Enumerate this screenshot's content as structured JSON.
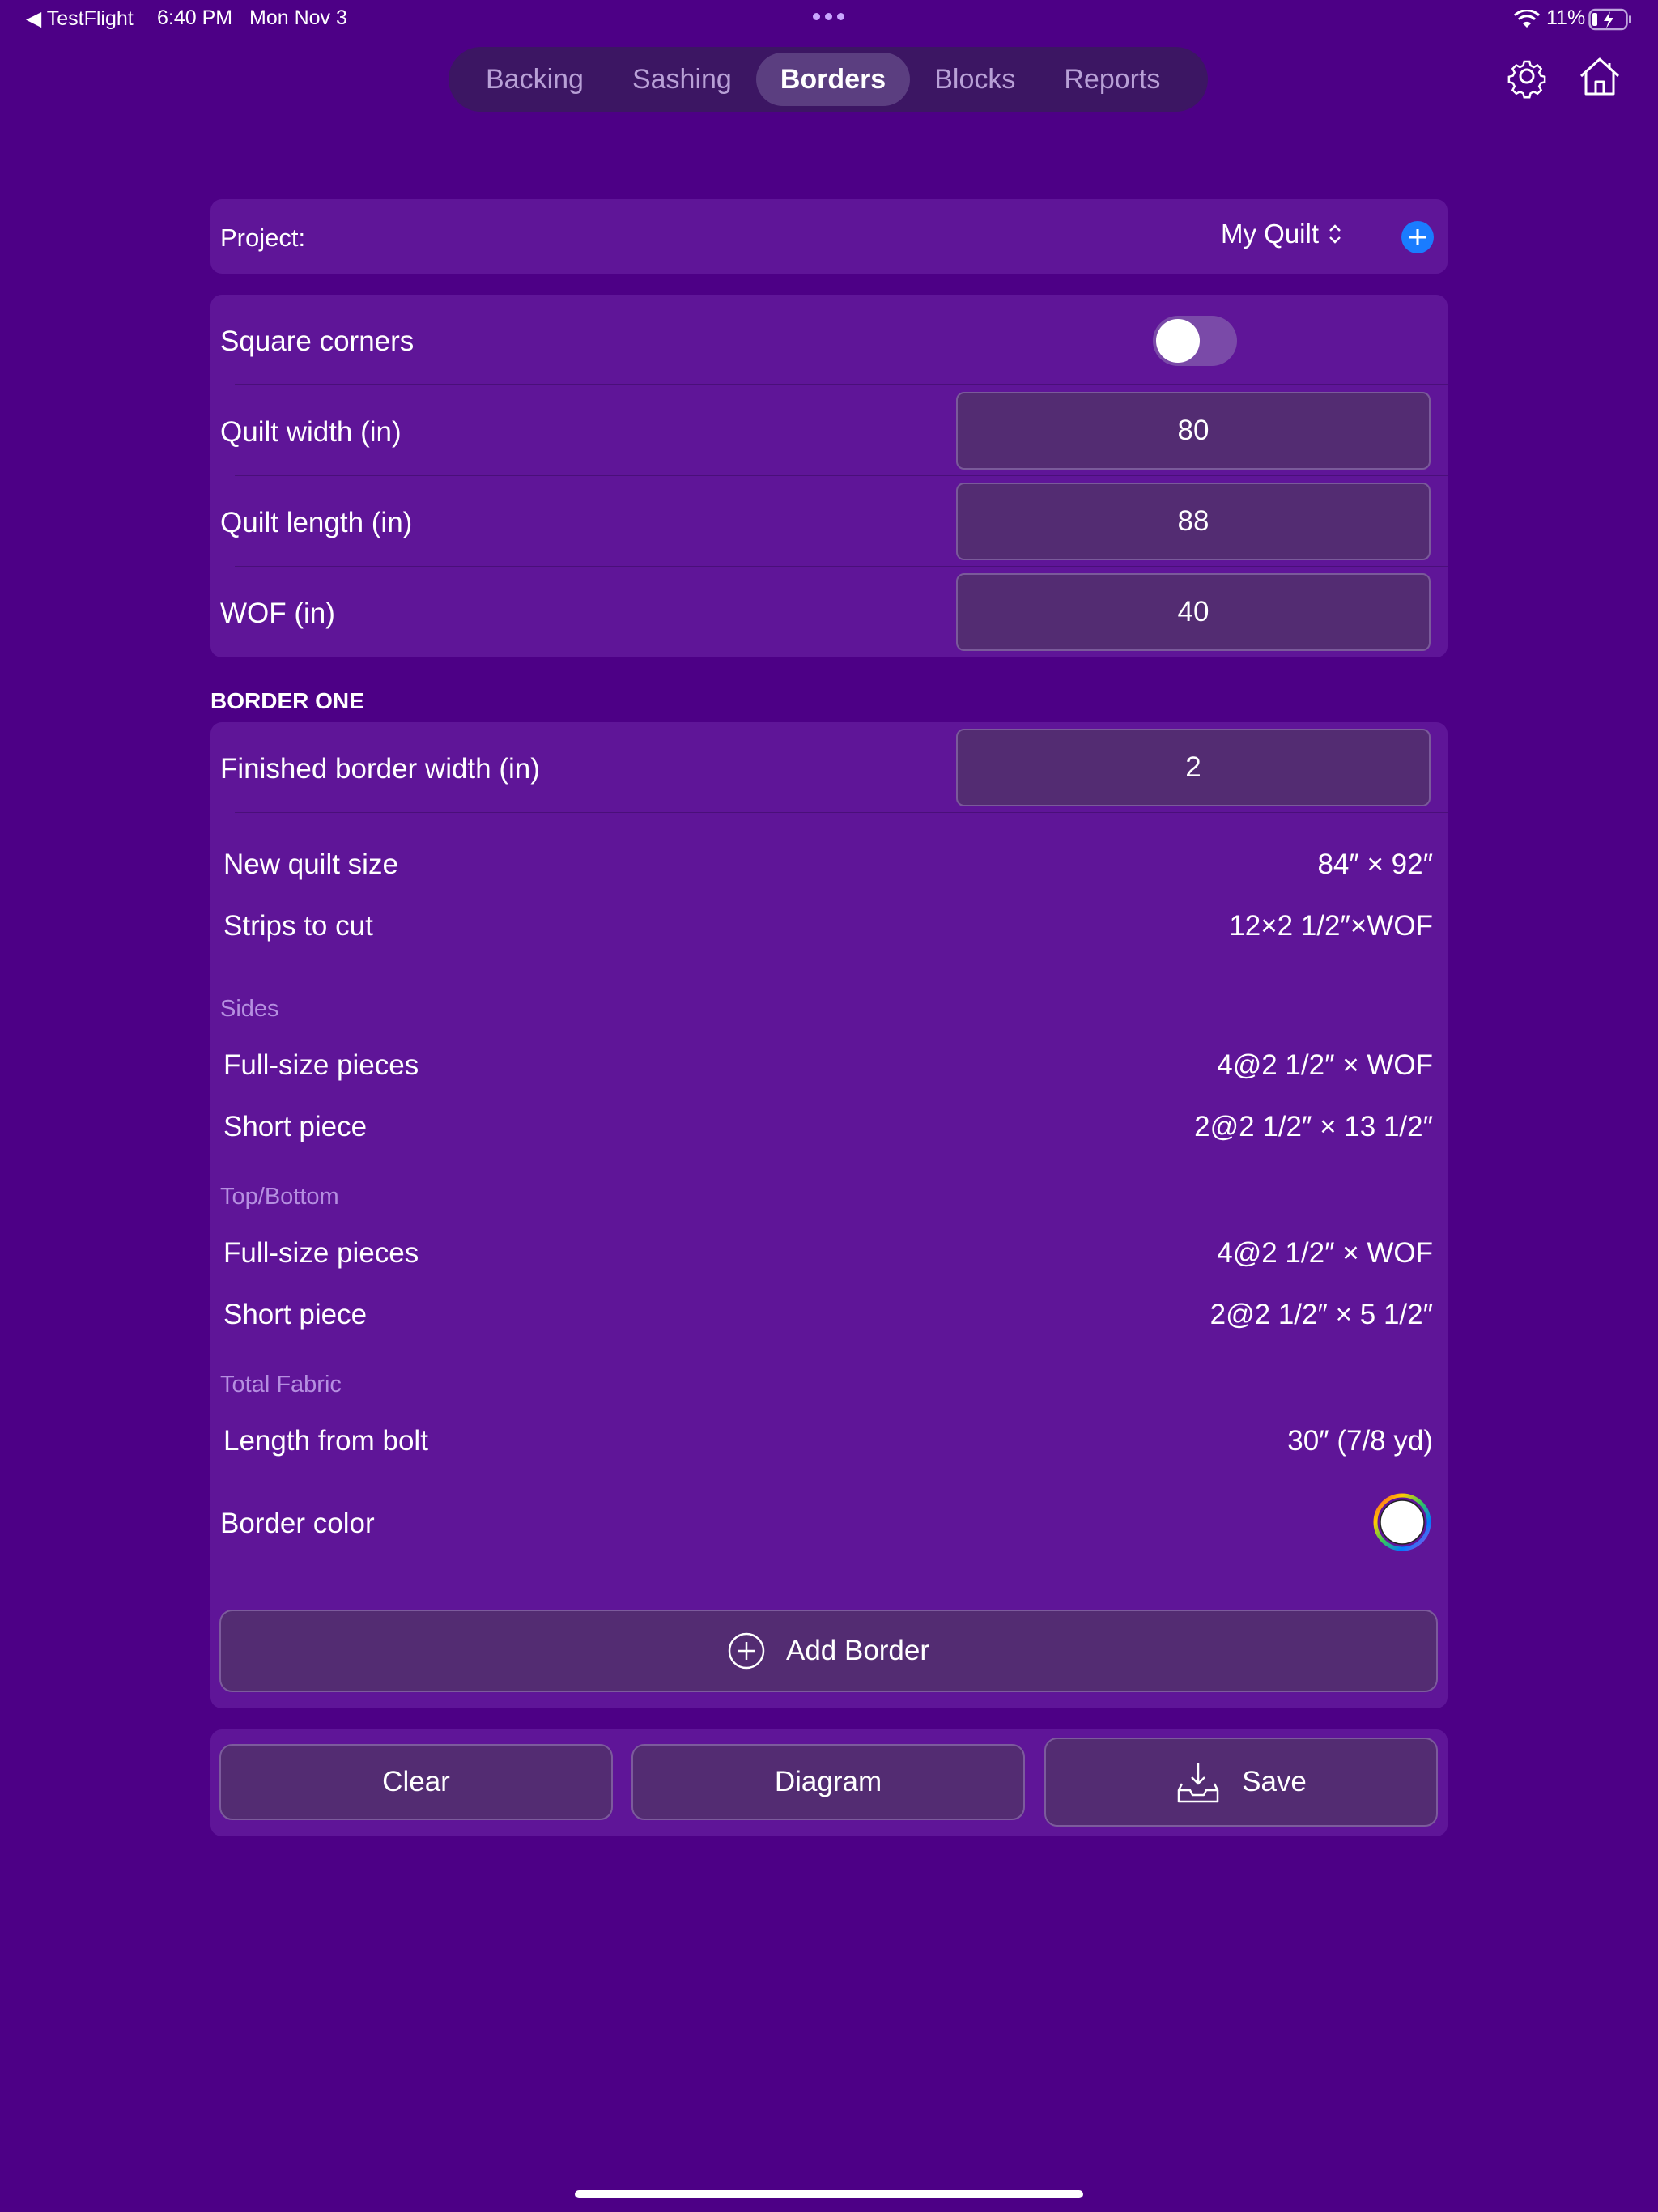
{
  "status_bar": {
    "back_app": "◀ TestFlight",
    "time": "6:40 PM",
    "date": "Mon Nov 3",
    "battery": "11%"
  },
  "tabs": [
    {
      "label": "Backing",
      "active": false
    },
    {
      "label": "Sashing",
      "active": false
    },
    {
      "label": "Borders",
      "active": true
    },
    {
      "label": "Blocks",
      "active": false
    },
    {
      "label": "Reports",
      "active": false
    }
  ],
  "toolbar_icons": [
    "gear-icon",
    "home-icon"
  ],
  "project": {
    "label": "Project:",
    "value": "My Quilt"
  },
  "quilt": {
    "square_corners_label": "Square corners",
    "square_corners_on": false,
    "width_label": "Quilt width (in)",
    "width_value": "80",
    "length_label": "Quilt length (in)",
    "length_value": "88",
    "wof_label": "WOF (in)",
    "wof_value": "40"
  },
  "border_one": {
    "header": "BORDER ONE",
    "finished_width_label": "Finished border width (in)",
    "finished_width_value": "2",
    "new_size_label": "New quilt size",
    "new_size_value": "84″ × 92″",
    "strips_label": "Strips to cut",
    "strips_value": "12×2 1/2″×WOF",
    "sides_header": "Sides",
    "sides_full_label": "Full-size pieces",
    "sides_full_value": "4@2 1/2″ × WOF",
    "sides_short_label": "Short piece",
    "sides_short_value": "2@2 1/2″ × 13 1/2″",
    "topbottom_header": "Top/Bottom",
    "tb_full_label": "Full-size pieces",
    "tb_full_value": "4@2 1/2″ × WOF",
    "tb_short_label": "Short piece",
    "tb_short_value": "2@2 1/2″ × 5 1/2″",
    "total_header": "Total Fabric",
    "length_label": "Length from bolt",
    "length_value": "30″  (7/8 yd)",
    "color_label": "Border color",
    "color_value": "#ffffff"
  },
  "actions": {
    "add_border": "Add Border",
    "clear": "Clear",
    "diagram": "Diagram",
    "save": "Save"
  },
  "colors": {
    "background": "#4d0086",
    "card": "#5f1598",
    "accent": "#1a7cff"
  }
}
